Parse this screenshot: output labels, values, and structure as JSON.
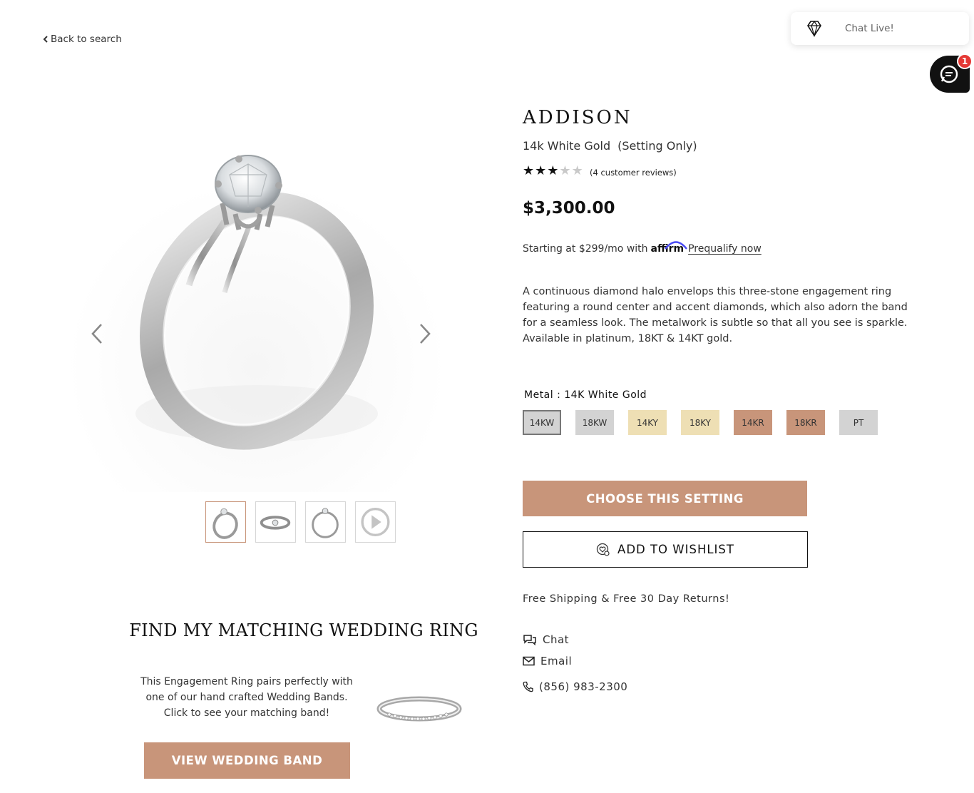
{
  "nav": {
    "back_label": "Back to search"
  },
  "chat_widget": {
    "label": "Chat Live!",
    "badge_count": "1"
  },
  "product": {
    "name": "ADDISON",
    "metal_name": "14k White Gold",
    "setting_note": "(Setting Only)",
    "rating": 3,
    "rating_max": 5,
    "reviews_text": "(4 customer reviews)",
    "price": "$3,300.00",
    "affirm": {
      "prefix": "Starting at $299/mo with",
      "logo_text": "affirm",
      "link": "Prequalify now"
    },
    "description": "A continuous diamond halo envelops this three-stone engagement ring featuring a round center and accent diamonds, which also adorn the band for a seamless look. The metalwork is subtle so that all you see is sparkle. Available in platinum, 18KT & 14KT gold."
  },
  "metal_selector": {
    "label": "Metal : 14K White Gold",
    "options": [
      {
        "code": "14KW",
        "color": "#d3d3d3",
        "selected": true
      },
      {
        "code": "18KW",
        "color": "#d3d3d3"
      },
      {
        "code": "14KY",
        "color": "#eedfb4"
      },
      {
        "code": "18KY",
        "color": "#eedfb4"
      },
      {
        "code": "14KR",
        "color": "#c8957a"
      },
      {
        "code": "18KR",
        "color": "#c8957a"
      },
      {
        "code": "PT",
        "color": "#d3d3d3"
      }
    ]
  },
  "actions": {
    "choose_label": "CHOOSE THIS SETTING",
    "wishlist_label": "ADD TO WISHLIST"
  },
  "shipping_text": "Free Shipping & Free 30 Day Returns!",
  "contact": {
    "chat": "Chat",
    "email": "Email",
    "phone": "(856) 983-2300"
  },
  "matching": {
    "title": "FIND MY MATCHING WEDDING RING",
    "text_lines": [
      "This Engagement Ring pairs perfectly with",
      "one of our hand crafted Wedding Bands.",
      "Click to see your matching band!"
    ],
    "button_label": "VIEW WEDDING BAND"
  },
  "gallery": {
    "thumbnails": [
      "ring-angle-view",
      "ring-front-view",
      "ring-side-view",
      "play-video"
    ]
  },
  "colors": {
    "accent": "#c8957a",
    "badge": "#e53935"
  }
}
